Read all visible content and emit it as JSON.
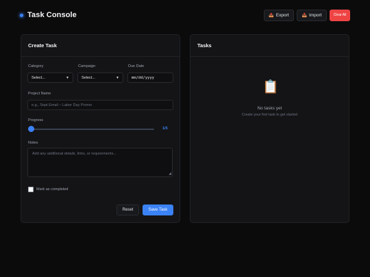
{
  "app": {
    "title": "Task Console"
  },
  "header": {
    "export_label": "Export",
    "import_label": "Import",
    "clear_label": "Clear All",
    "export_icon": "📤",
    "import_icon": "📥"
  },
  "create_panel": {
    "title": "Create Task",
    "category": {
      "label": "Category",
      "value": "Select..."
    },
    "campaign": {
      "label": "Campaign",
      "value": "Select..."
    },
    "due_date": {
      "label": "Due Date",
      "placeholder": "mm/dd/yyyy"
    },
    "project_name": {
      "label": "Project Name",
      "placeholder": "e.g., Sept Email – Labor Day Promo"
    },
    "progress": {
      "label": "Progress",
      "value": 1,
      "max": 5,
      "display": "1/5"
    },
    "notes": {
      "label": "Notes",
      "placeholder": "Add any additional details, links, or requirements..."
    },
    "completed": {
      "label": "Mark as completed",
      "checked": false
    },
    "reset_label": "Reset",
    "save_label": "Save Task"
  },
  "tasks_panel": {
    "title": "Tasks",
    "empty_icon": "📋",
    "empty_title": "No tasks yet",
    "empty_subtitle": "Create your first task to get started"
  },
  "colors": {
    "accent": "#3b82f6",
    "danger": "#ef4444",
    "background": "#0b0b0c",
    "panel": "#141416"
  }
}
